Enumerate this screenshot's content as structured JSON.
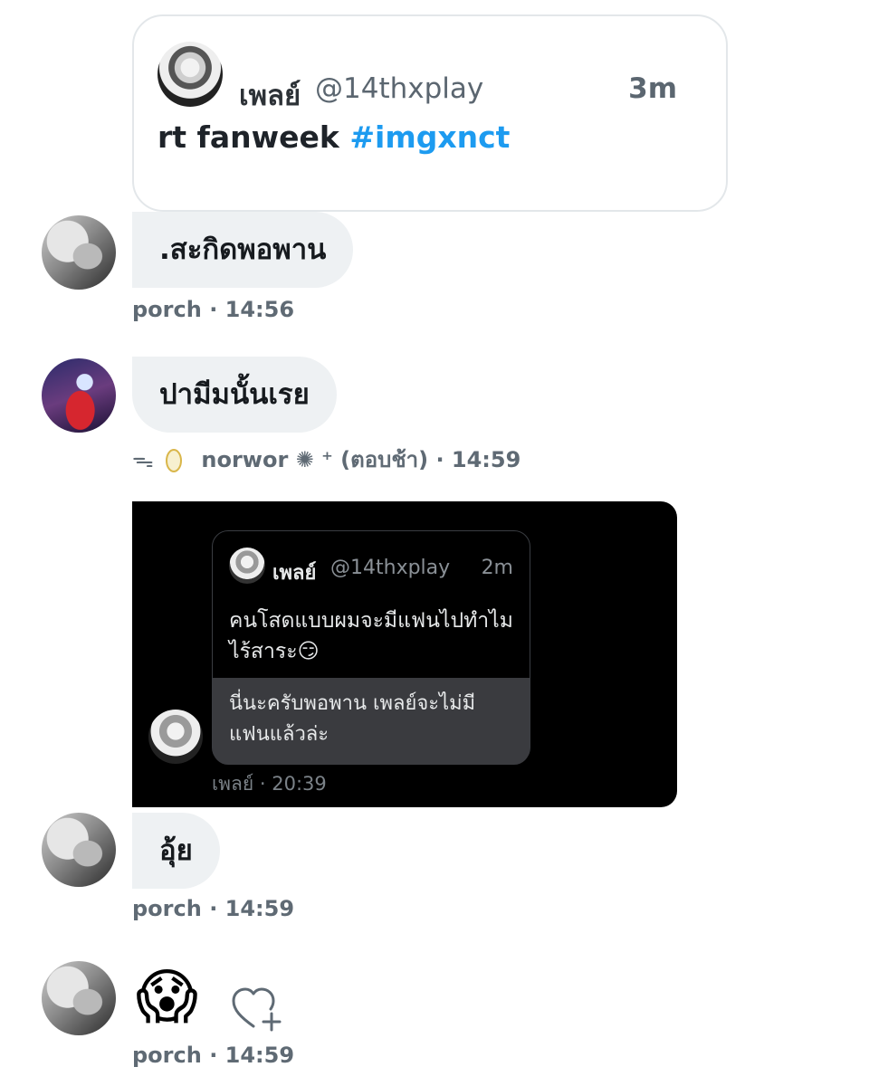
{
  "quoted_tweet": {
    "display_name": "เพลย์",
    "handle": "@14thxplay",
    "time": "3m",
    "text": "rt fanweek",
    "hashtag": "#imgxnct"
  },
  "messages": [
    {
      "text": ".สะกิดพอพาน",
      "sender": "porch",
      "time": "· 14:56"
    },
    {
      "text": "ปามีมนั้นเรย",
      "sender": "norwor ✺ ⁺ (ตอบช้า)",
      "sender_prefix": "ᯓ",
      "time": "· 14:59"
    },
    {
      "text": "อุ้ย",
      "sender": "porch",
      "time": "· 14:59"
    },
    {
      "emoji": "😱",
      "sender": "porch",
      "time": "· 14:59"
    }
  ],
  "screenshot": {
    "display_name": "เพลย์",
    "handle": "@14thxplay",
    "time": "2m",
    "text": "คนโสดแบบผมจะมีแฟนไปทำไม ไร้สาระ😏",
    "reply": "นี่นะครับพอพาน เพลย์จะไม่มีแฟนแล้วล่ะ",
    "meta": "เพลย์ · 20:39"
  },
  "icons": {
    "react": "heart-plus-icon"
  },
  "colors": {
    "hashtag": "#1d9bf0",
    "bubble": "#eef1f3",
    "meta_text": "#5f6a74"
  }
}
